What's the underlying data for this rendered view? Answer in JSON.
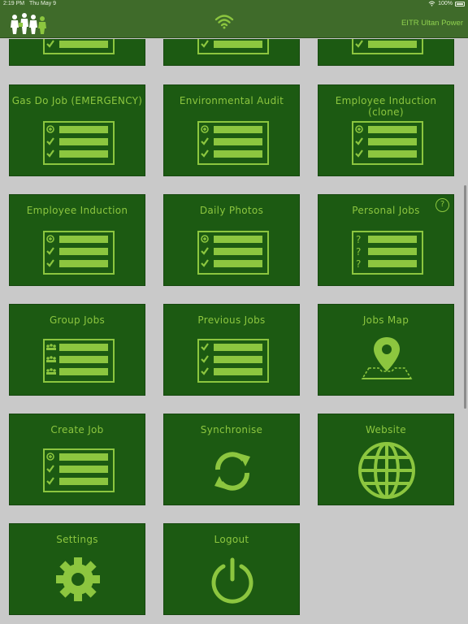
{
  "status": {
    "time": "2:19 PM",
    "date": "Thu May 9",
    "battery": "100%"
  },
  "navbar": {
    "title": "EITR Ultan Power",
    "logo_icon": "workers-logo-icon",
    "wifi_icon": "wifi-icon"
  },
  "tiles": {
    "gas_do_job": "Gas Do Job (EMERGENCY)",
    "environmental_audit": "Environmental Audit",
    "employee_induction_clone": "Employee Induction (clone)",
    "employee_induction": "Employee Induction",
    "daily_photos": "Daily Photos",
    "personal_jobs": "Personal Jobs",
    "personal_jobs_help": "?",
    "group_jobs": "Group Jobs",
    "previous_jobs": "Previous Jobs",
    "jobs_map": "Jobs Map",
    "create_job": "Create Job",
    "synchronise": "Synchronise",
    "website": "Website",
    "settings": "Settings",
    "logout": "Logout"
  },
  "colors": {
    "header": "#3f6b2a",
    "tile": "#1c5a12",
    "accent": "#8cc63f",
    "background": "#c9c9c9"
  }
}
